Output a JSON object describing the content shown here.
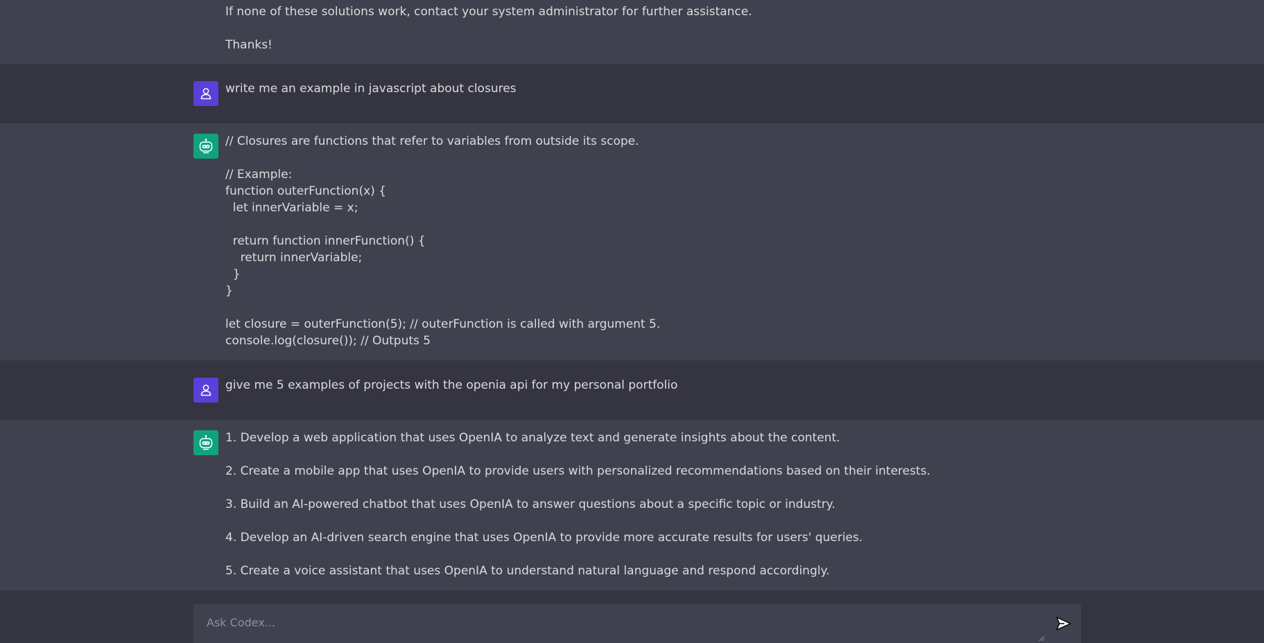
{
  "conversation": {
    "messages": [
      {
        "role": "assistant",
        "avatar": "bot-icon",
        "lines": [
          "If none of these solutions work, contact your system administrator for further assistance.",
          "",
          "Thanks!"
        ]
      },
      {
        "role": "user",
        "avatar": "user-icon",
        "lines": [
          "write me an example in javascript about closures"
        ]
      },
      {
        "role": "assistant",
        "avatar": "bot-icon",
        "lines": [
          "// Closures are functions that refer to variables from outside its scope.",
          "",
          "// Example:",
          "function outerFunction(x) {",
          "  let innerVariable = x;",
          "",
          "  return function innerFunction() {",
          "    return innerVariable;",
          "  }",
          "}",
          "",
          "let closure = outerFunction(5); // outerFunction is called with argument 5.",
          "console.log(closure()); // Outputs 5"
        ]
      },
      {
        "role": "user",
        "avatar": "user-icon",
        "lines": [
          "give me 5 examples of projects with the openia api for my personal portfolio"
        ]
      },
      {
        "role": "assistant",
        "avatar": "bot-icon",
        "lines": [
          "1. Develop a web application that uses OpenIA to analyze text and generate insights about the content.",
          "",
          "2. Create a mobile app that uses OpenIA to provide users with personalized recommendations based on their interests.",
          "",
          "3. Build an AI-powered chatbot that uses OpenIA to answer questions about a specific topic or industry.",
          "",
          "4. Develop an AI-driven search engine that uses OpenIA to provide more accurate results for users' queries.",
          "",
          "5. Create a voice assistant that uses OpenIA to understand natural language and respond accordingly."
        ]
      }
    ]
  },
  "composer": {
    "placeholder": "Ask Codex...",
    "value": "",
    "send_icon": "send-icon"
  },
  "colors": {
    "background": "#343541",
    "assistant_row": "#40414f",
    "user_avatar": "#5b3fd9",
    "bot_avatar": "#10a37f",
    "text": "#dcdcdc",
    "placeholder": "#8e8ea0"
  }
}
